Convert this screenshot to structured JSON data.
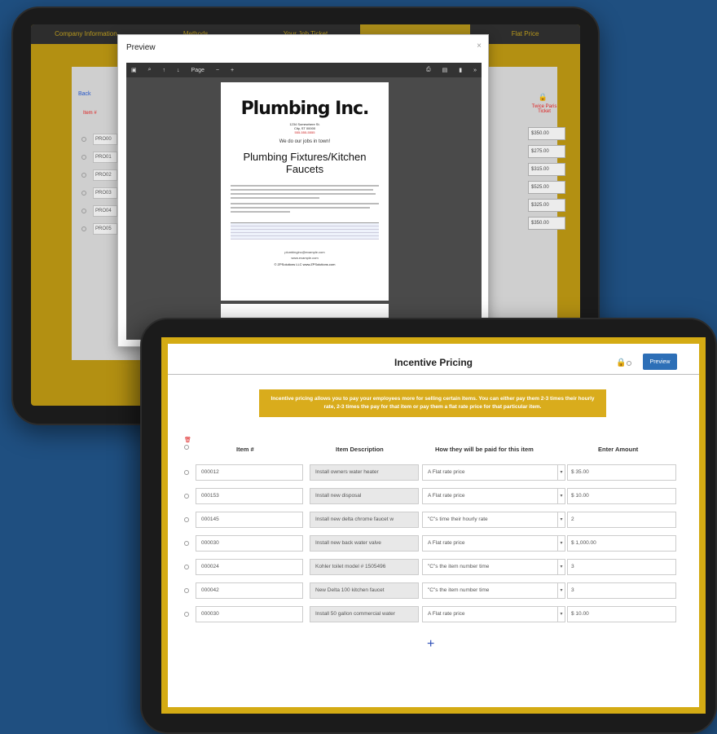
{
  "back_tablet": {
    "nav": [
      "Company Information",
      "Methods",
      "Your Job Ticket",
      "",
      "Flat Price"
    ],
    "link": "Back",
    "column_item": "Item #",
    "column_price": "Twice Paris Ticket",
    "rows": [
      "PRO00",
      "PRO01",
      "PRO02",
      "PRO03",
      "PRO04",
      "PRO05"
    ],
    "prices": [
      "$350.00",
      "$275.00",
      "$315.00",
      "$525.00",
      "$325.00",
      "$350.00"
    ],
    "preview": {
      "title": "Preview",
      "close": "×",
      "toolbar_page": "Page",
      "document": {
        "company": "Plumbing Inc.",
        "address": [
          "1234 Somewhere St.",
          "City, ST 00000",
          "555-555-5555"
        ],
        "tagline": "We do our jobs in town!",
        "heading": "Plumbing Fixtures/Kitchen Faucets",
        "email": "plumbinginc@example.com",
        "website": "www.example.com",
        "copyright": "© ZPSolutions LLC www.ZPSolutions.com"
      }
    }
  },
  "front_tablet": {
    "title": "Incentive Pricing",
    "preview_button": "Preview",
    "notice": "Incentive pricing allows you to pay your employees more for selling certain items. You can either pay them 2-3 times their hourly rate, 2-3 times the pay for that item or pay them a flat rate price for that particular item.",
    "columns": {
      "item": "Item #",
      "description": "Item Description",
      "paid": "How they will be paid for this item",
      "amount": "Enter Amount"
    },
    "rows": [
      {
        "item": "000012",
        "description": "Install owners water heater",
        "paid": "A Flat rate price",
        "amount": "$ 35.00"
      },
      {
        "item": "000153",
        "description": "Install new disposal",
        "paid": "A Flat rate price",
        "amount": "$ 10.00"
      },
      {
        "item": "000145",
        "description": "Install new delta chrome faucet w",
        "paid": "\"C\"s time their hourly rate",
        "amount": "2"
      },
      {
        "item": "000030",
        "description": "Install new back water valve",
        "paid": "A Flat rate price",
        "amount": "$ 1,000.00"
      },
      {
        "item": "000024",
        "description": "Kohler toilet model # 1505496",
        "paid": "\"C\"s the item number time",
        "amount": "3"
      },
      {
        "item": "000042",
        "description": "New Delta 100 kitchen faucet",
        "paid": "\"C\"s the item number time",
        "amount": "3"
      },
      {
        "item": "000030",
        "description": "Install 50 gallon commercial water",
        "paid": "A Flat rate price",
        "amount": "$ 10.00"
      }
    ],
    "add_label": "+"
  }
}
